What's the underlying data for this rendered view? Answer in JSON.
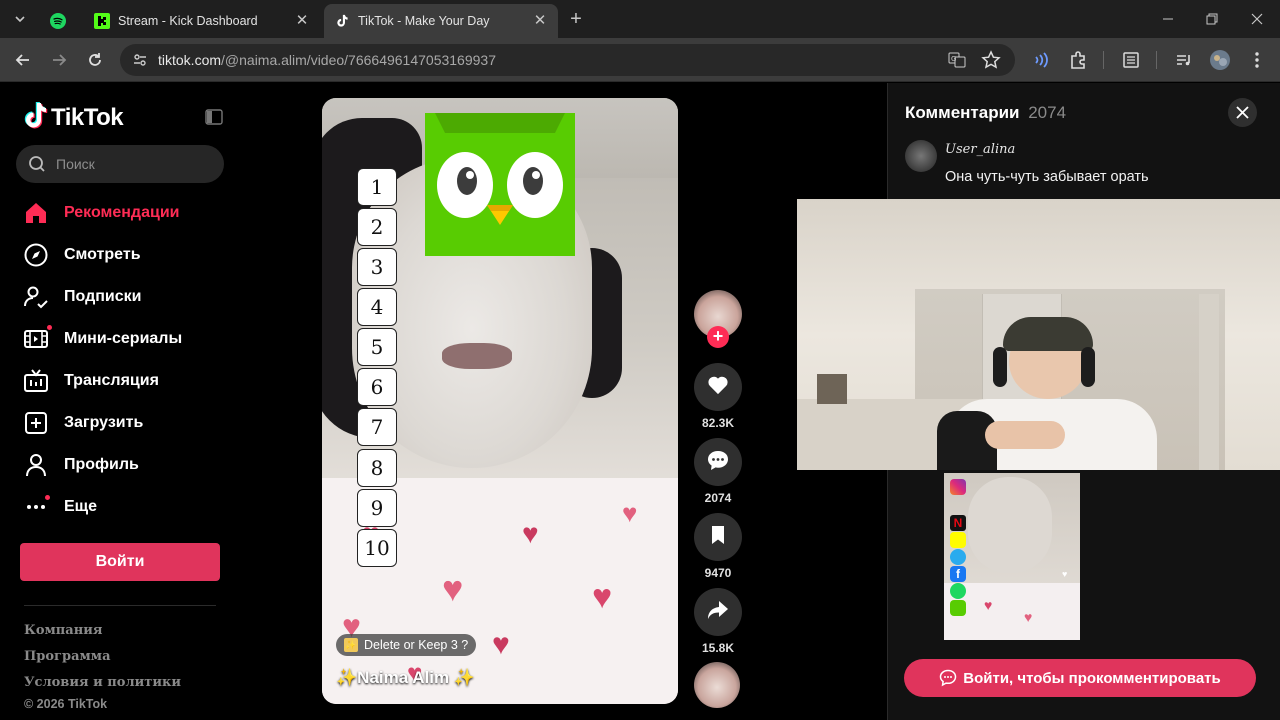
{
  "browser": {
    "tabs": [
      {
        "label": ""
      },
      {
        "label": "Stream - Kick Dashboard"
      },
      {
        "label": "TikTok - Make Your Day"
      }
    ],
    "url_host": "tiktok.com",
    "url_path": "/@naima.alim/video/7666496147053169937"
  },
  "sidebar": {
    "logo": "TikTok",
    "search_placeholder": "Поиск",
    "items": [
      {
        "label": "Рекомендации"
      },
      {
        "label": "Смотреть"
      },
      {
        "label": "Подписки"
      },
      {
        "label": "Мини-сериалы"
      },
      {
        "label": "Трансляция"
      },
      {
        "label": "Загрузить"
      },
      {
        "label": "Профиль"
      },
      {
        "label": "Еще"
      }
    ],
    "login_label": "Войти",
    "footer": [
      "Компания",
      "Программа",
      "Условия и политики"
    ],
    "copyright": "© 2026 TikTok"
  },
  "video": {
    "numbers": [
      "1",
      "2",
      "3",
      "4",
      "5",
      "6",
      "7",
      "8",
      "9",
      "10"
    ],
    "pill_text": "Delete or Keep 3 ?",
    "author_line": "✨Naima Alim ✨"
  },
  "actions": {
    "likes": "82.3K",
    "comments": "2074",
    "saves": "9470",
    "shares": "15.8K"
  },
  "comments": {
    "title": "Комментарии",
    "count": "2074",
    "first_user": "User_alina",
    "first_text": "Она чуть-чуть забывает орать",
    "login_cta": "Войти, чтобы прокомментировать"
  },
  "colors": {
    "accent": "#fe2c55",
    "login_button": "#e0345c",
    "duolingo_green": "#58cc02"
  }
}
